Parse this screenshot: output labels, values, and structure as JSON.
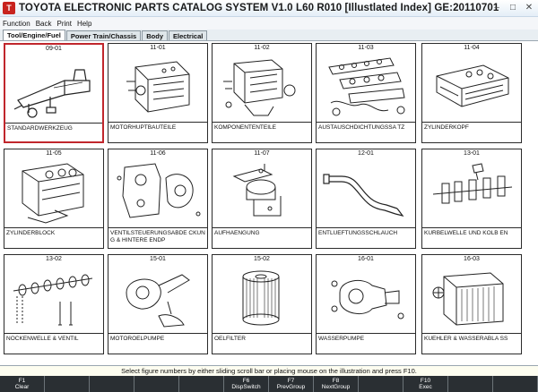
{
  "window": {
    "title": "TOYOTA ELECTRONIC PARTS CATALOG SYSTEM V1.0 L60 R010 [Illustlated Index] GE:20110701",
    "controls": [
      "–",
      "□",
      "✕"
    ]
  },
  "menu": [
    "Function",
    "Back",
    "Print",
    "Help"
  ],
  "tabs": [
    "Tool/Engine/Fuel",
    "Power Train/Chassis",
    "Body",
    "Electrical"
  ],
  "cards": [
    {
      "code": "09-01",
      "label": "STANDARDWERKZEUG",
      "icon": "jack-icon"
    },
    {
      "code": "11-01",
      "label": "MOTORHUPTBAUTEILE",
      "icon": "engine-block-icon"
    },
    {
      "code": "11-02",
      "label": "KOMPONENTENTEILE",
      "icon": "engine-components-icon"
    },
    {
      "code": "11-03",
      "label": "AUSTAUSCHDICHTUNGSSA TZ",
      "icon": "gasket-set-icon"
    },
    {
      "code": "11-04",
      "label": "ZYLINDERKOPF",
      "icon": "cylinder-head-icon"
    },
    {
      "code": "11-05",
      "label": "ZYLINDERBLOCK",
      "icon": "cylinder-block-icon"
    },
    {
      "code": "11-06",
      "label": "VENTILSTEUERUNGSABDE CKUNG & HINTERE ENDP",
      "icon": "timing-cover-icon"
    },
    {
      "code": "11-07",
      "label": "AUFHAENGUNG",
      "icon": "engine-mount-icon"
    },
    {
      "code": "12-01",
      "label": "ENTLUEFTUNGSSCHLAUCH",
      "icon": "ventilation-hose-icon"
    },
    {
      "code": "13-01",
      "label": "KURBELWELLE UND KOLB EN",
      "icon": "crankshaft-icon"
    },
    {
      "code": "13-02",
      "label": "NOCKENWELLE & VENTIL",
      "icon": "camshaft-icon"
    },
    {
      "code": "15-01",
      "label": "MOTOROELPUMPE",
      "icon": "oil-pump-icon"
    },
    {
      "code": "15-02",
      "label": "OELFILTER",
      "icon": "oil-filter-icon"
    },
    {
      "code": "16-01",
      "label": "WASSERPUMPE",
      "icon": "water-pump-icon"
    },
    {
      "code": "16-03",
      "label": "KUEHLER & WASSERABLA SS",
      "icon": "radiator-icon"
    }
  ],
  "selected_code": "09-01",
  "status_message": "Select figure numbers by either sliding scroll bar or placing mouse on the illustration and press F10.",
  "fkeys": [
    {
      "key": "F1",
      "label": "Clear"
    },
    {
      "key": "",
      "label": ""
    },
    {
      "key": "",
      "label": ""
    },
    {
      "key": "",
      "label": ""
    },
    {
      "key": "",
      "label": ""
    },
    {
      "key": "F6",
      "label": "DispSwitch"
    },
    {
      "key": "F7",
      "label": "PrevGroup"
    },
    {
      "key": "F8",
      "label": "NextGroup"
    },
    {
      "key": "",
      "label": ""
    },
    {
      "key": "F10",
      "label": "Exec"
    },
    {
      "key": "",
      "label": ""
    },
    {
      "key": "",
      "label": ""
    }
  ],
  "colors": {
    "selected_border": "#c0262c",
    "fkey_bar": "#2a2f33"
  }
}
